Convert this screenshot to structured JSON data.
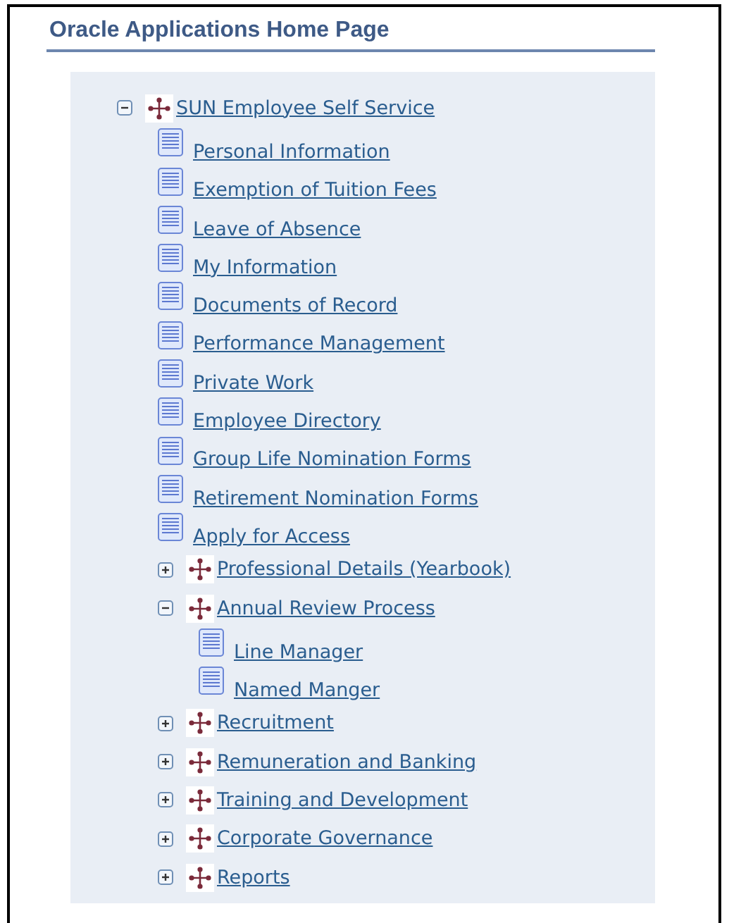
{
  "title": "Oracle Applications Home Page",
  "tree": [
    {
      "kind": "folder",
      "label": "SUN Employee Self Service",
      "expanded": true,
      "children": [
        {
          "kind": "leaf",
          "label": "Personal Information"
        },
        {
          "kind": "leaf",
          "label": "Exemption of Tuition Fees"
        },
        {
          "kind": "leaf",
          "label": "Leave of Absence"
        },
        {
          "kind": "leaf",
          "label": "My Information"
        },
        {
          "kind": "leaf",
          "label": "Documents of Record"
        },
        {
          "kind": "leaf",
          "label": "Performance Management"
        },
        {
          "kind": "leaf",
          "label": "Private Work"
        },
        {
          "kind": "leaf",
          "label": "Employee Directory"
        },
        {
          "kind": "leaf",
          "label": "Group Life Nomination Forms"
        },
        {
          "kind": "leaf",
          "label": "Retirement Nomination Forms"
        },
        {
          "kind": "leaf",
          "label": "Apply for Access"
        },
        {
          "kind": "folder",
          "label": "Professional Details (Yearbook)",
          "expanded": false
        },
        {
          "kind": "folder",
          "label": "Annual Review Process",
          "expanded": true,
          "children": [
            {
              "kind": "leaf",
              "label": "Line Manager"
            },
            {
              "kind": "leaf",
              "label": "Named Manger"
            }
          ]
        },
        {
          "kind": "folder",
          "label": "Recruitment",
          "expanded": false
        },
        {
          "kind": "folder",
          "label": "Remuneration and Banking",
          "expanded": false
        },
        {
          "kind": "folder",
          "label": "Training and Development",
          "expanded": false
        },
        {
          "kind": "folder",
          "label": "Corporate Governance",
          "expanded": false
        },
        {
          "kind": "folder",
          "label": "Reports",
          "expanded": false
        }
      ]
    }
  ]
}
